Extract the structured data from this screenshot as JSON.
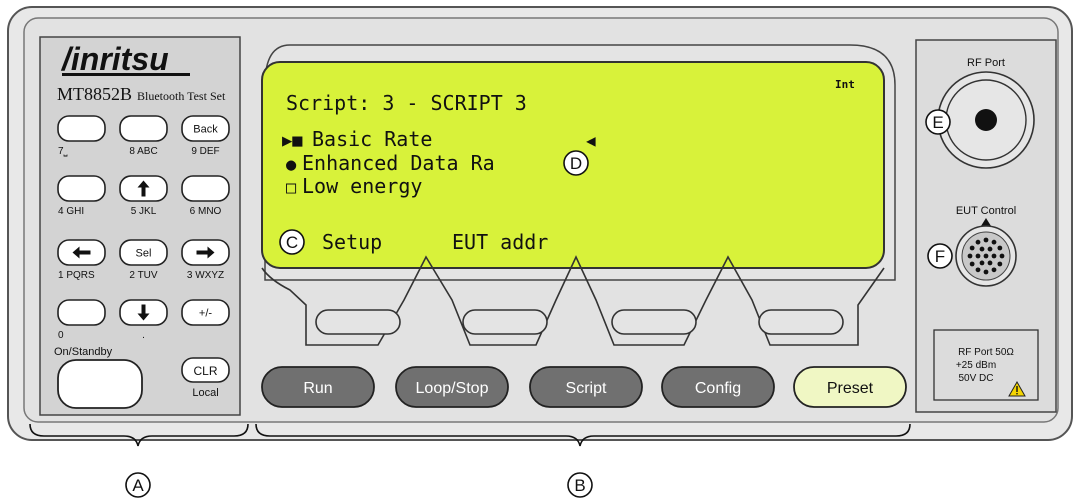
{
  "brand": {
    "logo": "/inritsu",
    "model": "MT8852B",
    "model_suffix": "Bluetooth Test Set"
  },
  "keypad": {
    "keys": [
      {
        "name": "key-7",
        "face": "",
        "label": "7⎵",
        "icon": ""
      },
      {
        "name": "key-8",
        "face": "",
        "label": "8 ABC",
        "icon": ""
      },
      {
        "name": "key-back",
        "face": "Back",
        "label": "9 DEF",
        "icon": ""
      },
      {
        "name": "key-4",
        "face": "",
        "label": "4 GHI",
        "icon": ""
      },
      {
        "name": "key-up",
        "face": "",
        "label": "5 JKL",
        "icon": "arrow-up-icon"
      },
      {
        "name": "key-6",
        "face": "",
        "label": "6 MNO",
        "icon": ""
      },
      {
        "name": "key-left",
        "face": "",
        "label": "1 PQRS",
        "icon": "arrow-left-icon"
      },
      {
        "name": "key-sel",
        "face": "Sel",
        "label": "2 TUV",
        "icon": ""
      },
      {
        "name": "key-right",
        "face": "",
        "label": "3 WXYZ",
        "icon": "arrow-right-icon"
      },
      {
        "name": "key-0",
        "face": "",
        "label": "0",
        "icon": ""
      },
      {
        "name": "key-down",
        "face": "",
        "label": ".",
        "icon": "arrow-down-icon"
      },
      {
        "name": "key-plusminus",
        "face": "+/-",
        "label": "",
        "icon": ""
      }
    ],
    "standby_label": "On/Standby",
    "clr_label": "CLR",
    "local_label": "Local"
  },
  "display": {
    "indicator": "Int",
    "title": "Script: 3 - SCRIPT 3",
    "options": [
      {
        "marker": "▶■",
        "text": "Basic Rate"
      },
      {
        "marker": "●",
        "text": "Enhanced Data Ra"
      },
      {
        "marker": "□",
        "text": "Low energy"
      }
    ],
    "selection_marker": "◀",
    "softkey_labels": [
      "Setup",
      "EUT addr"
    ]
  },
  "function_buttons": [
    "Run",
    "Loop/Stop",
    "Script",
    "Config",
    "Preset"
  ],
  "ports": {
    "rf_port_label": "RF Port",
    "eut_control_label": "EUT Control",
    "warning_lines": [
      "RF Port 50Ω",
      "+25 dBm",
      "50V DC"
    ],
    "warning_icon": "warning-triangle-icon"
  },
  "callouts": [
    "A",
    "B",
    "C",
    "D",
    "E",
    "F"
  ],
  "colors": {
    "lcd": "#d8f23a",
    "panel": "#e6e6e6",
    "keypad_panel": "#d4d4d4",
    "dark_button": "#707070",
    "preset_button": "#f0f7c4"
  }
}
